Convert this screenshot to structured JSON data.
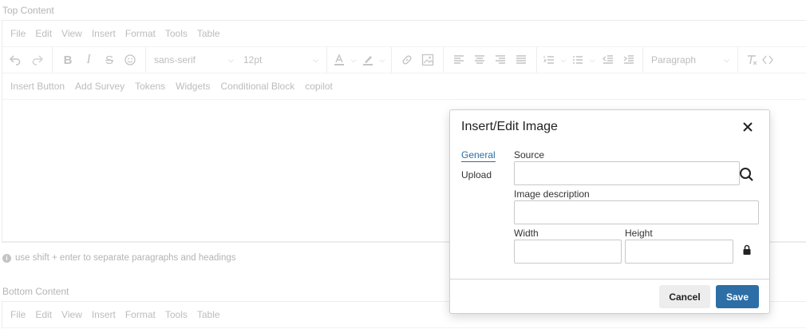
{
  "top": {
    "label": "Top Content",
    "menu": [
      "File",
      "Edit",
      "View",
      "Insert",
      "Format",
      "Tools",
      "Table"
    ],
    "font_family": "sans-serif",
    "font_size": "12pt",
    "block_format": "Paragraph",
    "custom_buttons": [
      "Insert Button",
      "Add Survey",
      "Tokens",
      "Widgets",
      "Conditional Block",
      "copilot"
    ]
  },
  "hint": "use shift + enter to separate paragraphs and headings",
  "bottom": {
    "label": "Bottom Content",
    "menu": [
      "File",
      "Edit",
      "View",
      "Insert",
      "Format",
      "Tools",
      "Table"
    ]
  },
  "dialog": {
    "title": "Insert/Edit Image",
    "tabs": [
      "General",
      "Upload"
    ],
    "source_label": "Source",
    "source_value": "",
    "description_label": "Image description",
    "description_value": "",
    "width_label": "Width",
    "width_value": "",
    "height_label": "Height",
    "height_value": "",
    "cancel_label": "Cancel",
    "save_label": "Save"
  },
  "colors": {
    "accent": "#2c6ea5",
    "muted_text": "#b7b7b7"
  },
  "icons": [
    "undo-icon",
    "redo-icon",
    "bold-icon",
    "italic-icon",
    "strikethrough-icon",
    "emoji-icon",
    "text-color-icon",
    "highlight-icon",
    "link-icon",
    "image-icon",
    "align-left-icon",
    "align-center-icon",
    "align-right-icon",
    "justify-icon",
    "numbered-list-icon",
    "bullet-list-icon",
    "outdent-icon",
    "indent-icon",
    "clear-format-icon",
    "code-icon",
    "close-icon",
    "search-icon",
    "lock-icon"
  ]
}
